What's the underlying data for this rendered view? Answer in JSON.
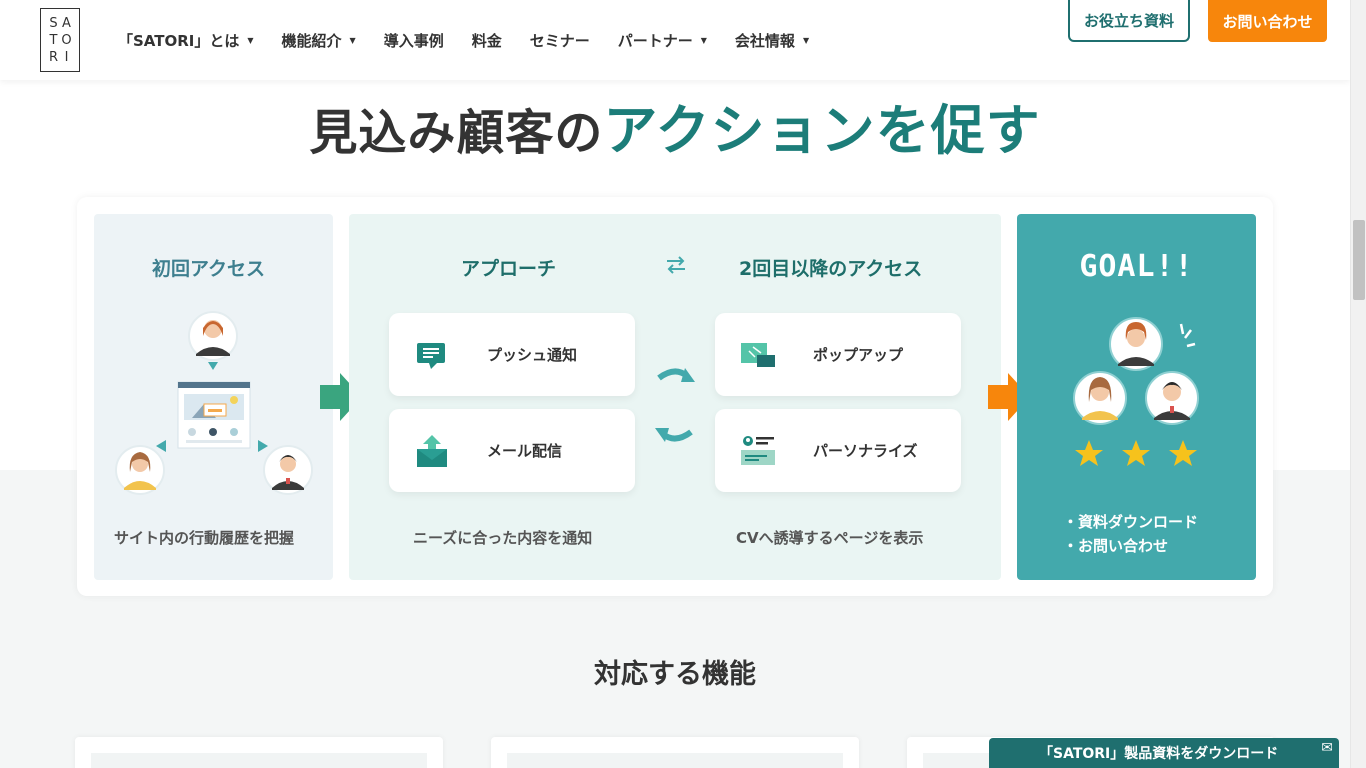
{
  "header": {
    "logo_letters": [
      "S",
      "A",
      "T",
      "O",
      "R",
      "I"
    ],
    "nav": [
      {
        "label": "「SATORI」とは",
        "caret": true
      },
      {
        "label": "機能紹介",
        "caret": true
      },
      {
        "label": "導入事例",
        "caret": false
      },
      {
        "label": "料金",
        "caret": false
      },
      {
        "label": "セミナー",
        "caret": false
      },
      {
        "label": "パートナー",
        "caret": true
      },
      {
        "label": "会社情報",
        "caret": true
      }
    ],
    "docs_button": "お役立ち資料",
    "contact_button": "お問い合わせ"
  },
  "hero": {
    "title_dark": "見込み顧客の",
    "title_teal": "アクションを促す"
  },
  "flow": {
    "first_access": {
      "title": "初回アクセス",
      "caption": "サイト内の行動履歴を把握"
    },
    "approach": {
      "title": "アプローチ",
      "caption": "ニーズに合った内容を通知",
      "cards": [
        "プッシュ通知",
        "メール配信"
      ]
    },
    "repeat_access": {
      "title": "2回目以降のアクセス",
      "caption": "CVへ誘導するページを表示",
      "cards": [
        "ポップアップ",
        "パーソナライズ"
      ]
    },
    "goal": {
      "title": "GOAL!!",
      "items": [
        "・資料ダウンロード",
        "・お問い合わせ"
      ]
    }
  },
  "features_title": "対応する機能",
  "download_bar": "「SATORI」製品資料をダウンロード",
  "colors": {
    "teal": "#1c7d79",
    "goal": "#43a9ac",
    "orange": "#f7860c",
    "green_arrow": "#3aa57f"
  }
}
